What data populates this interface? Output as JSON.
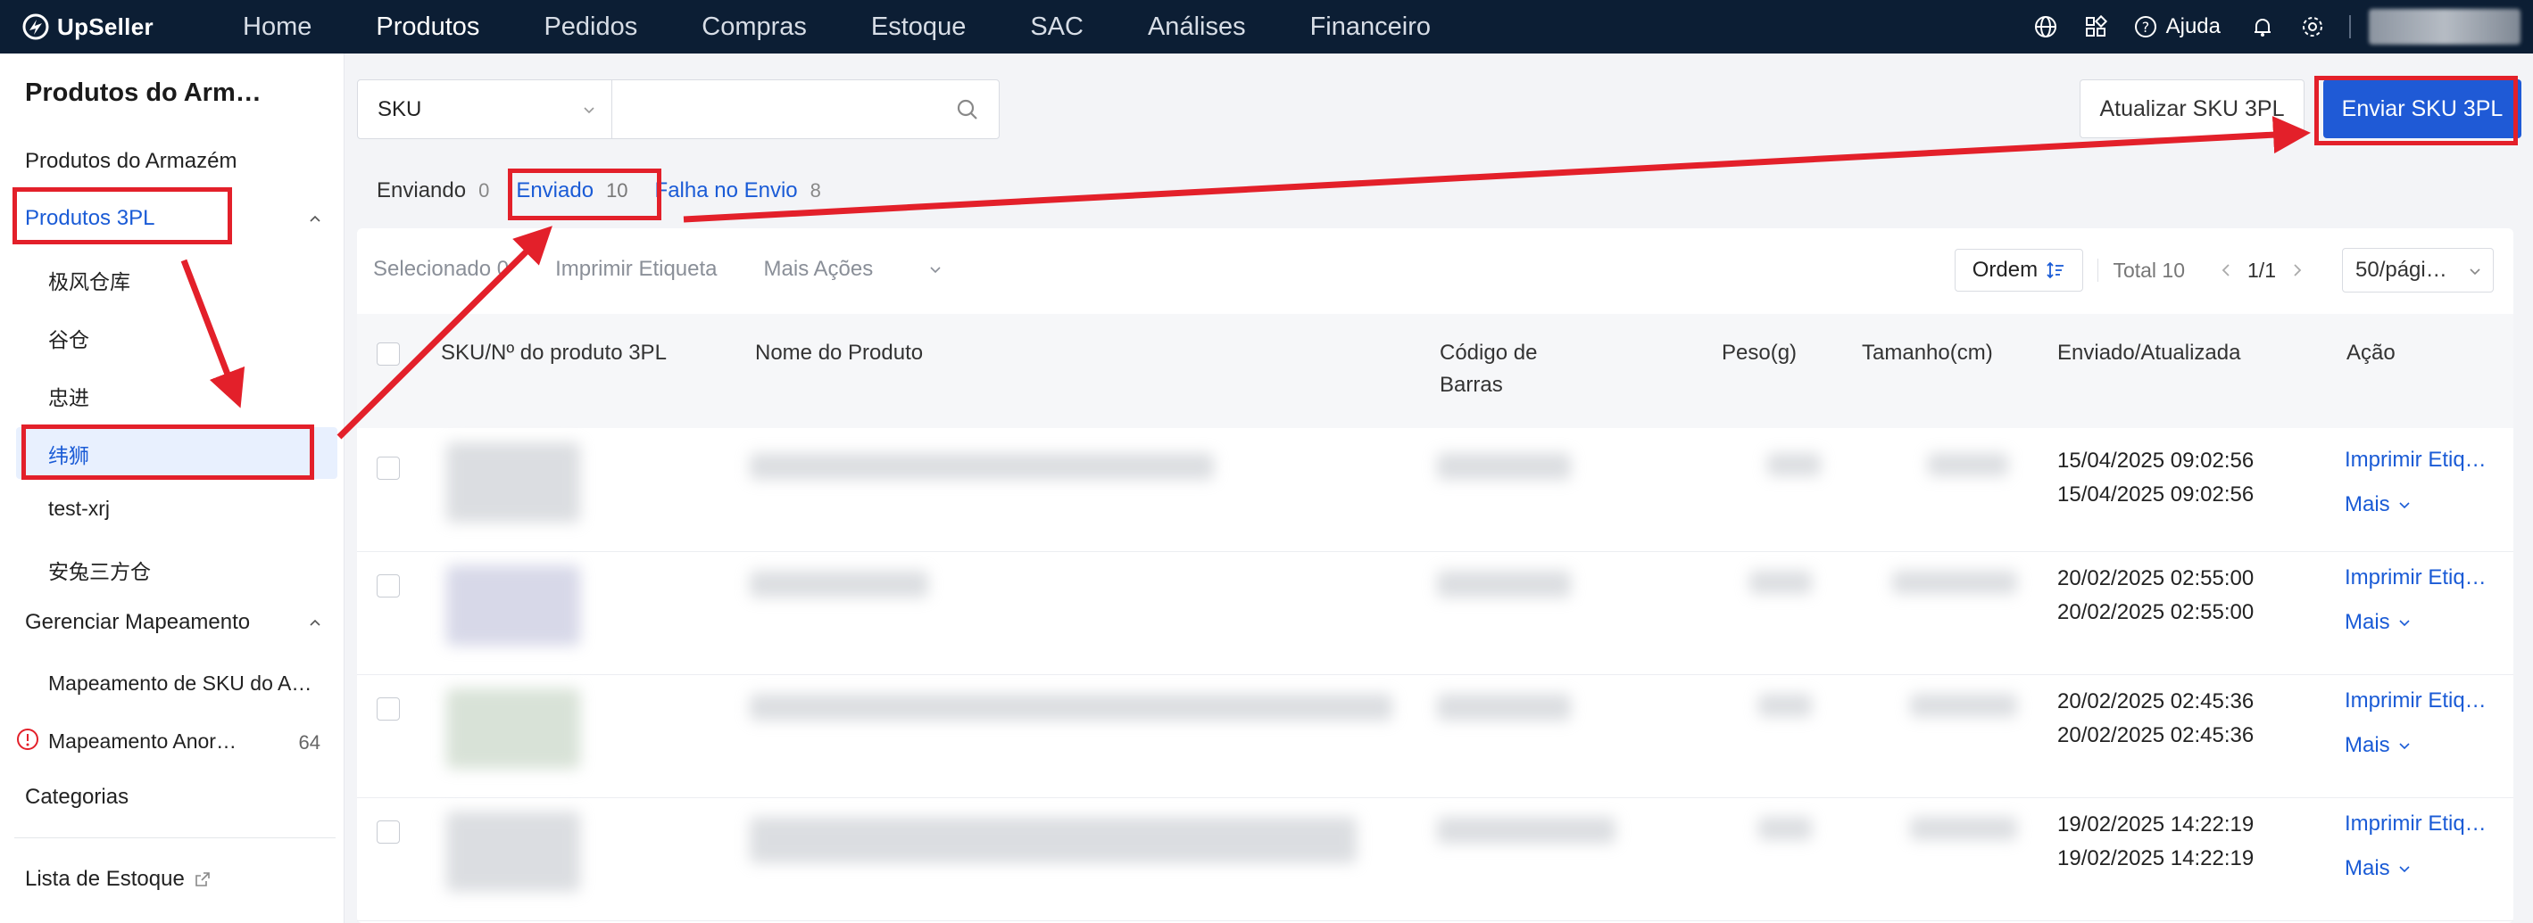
{
  "brand": {
    "name": "UpSeller"
  },
  "nav": {
    "items": [
      {
        "label": "Home"
      },
      {
        "label": "Produtos",
        "active": true
      },
      {
        "label": "Pedidos"
      },
      {
        "label": "Compras"
      },
      {
        "label": "Estoque"
      },
      {
        "label": "SAC"
      },
      {
        "label": "Análises"
      },
      {
        "label": "Financeiro"
      }
    ],
    "help_label": "Ajuda",
    "icons": [
      "globe-icon",
      "apps-grid-icon",
      "help-circle-icon",
      "bell-icon",
      "gear-icon"
    ]
  },
  "sidebar": {
    "title": "Produtos do Arm…",
    "items": {
      "warehouse_products": "Produtos do Armazém",
      "products_3pl": "Produtos 3PL",
      "sub_3pl": [
        "极风仓库",
        "谷仓",
        "忠进",
        "纬狮",
        "test-xrj",
        "安兔三方仓"
      ],
      "manage_mapping": "Gerenciar Mapeamento",
      "mapping_sku": "Mapeamento de SKU do A…",
      "mapping_abnormal": "Mapeamento Anor…",
      "mapping_abnormal_count": "64",
      "categories": "Categorias",
      "stock_list": "Lista de Estoque"
    }
  },
  "search": {
    "type_value": "SKU",
    "placeholder": ""
  },
  "actions": {
    "update_label": "Atualizar SKU 3PL",
    "send_label": "Enviar SKU 3PL"
  },
  "tabs": [
    {
      "label": "Enviando",
      "count": "0"
    },
    {
      "label": "Enviado",
      "count": "10",
      "active": true
    },
    {
      "label": "Falha no Envio",
      "count": "8"
    }
  ],
  "toolbar": {
    "selected_label": "Selecionado 0",
    "print_label": "Imprimir Etiqueta",
    "more_actions_label": "Mais Ações",
    "order_label": "Ordem",
    "total_label": "Total 10",
    "page_label": "1/1",
    "page_size_label": "50/pági…"
  },
  "table": {
    "headers": {
      "sku": "SKU/Nº do produto 3PL",
      "name": "Nome do Produto",
      "barcode_l1": "Código de",
      "barcode_l2": "Barras",
      "weight": "Peso(g)",
      "size": "Tamanho(cm)",
      "sent_updated": "Enviado/Atualizada",
      "action": "Ação"
    },
    "rows": [
      {
        "sent": "15/04/2025 09:02:56",
        "updated": "15/04/2025 09:02:56",
        "print": "Imprimir Etiq…",
        "more": "Mais"
      },
      {
        "sent": "20/02/2025 02:55:00",
        "updated": "20/02/2025 02:55:00",
        "print": "Imprimir Etiq…",
        "more": "Mais"
      },
      {
        "sent": "20/02/2025 02:45:36",
        "updated": "20/02/2025 02:45:36",
        "print": "Imprimir Etiq…",
        "more": "Mais"
      },
      {
        "sent": "19/02/2025 14:22:19",
        "updated": "19/02/2025 14:22:19",
        "print": "Imprimir Etiq…",
        "more": "Mais"
      }
    ]
  },
  "colors": {
    "nav_bg": "#0c1e34",
    "accent": "#1a5bd6",
    "annotation_red": "#e3202a"
  }
}
